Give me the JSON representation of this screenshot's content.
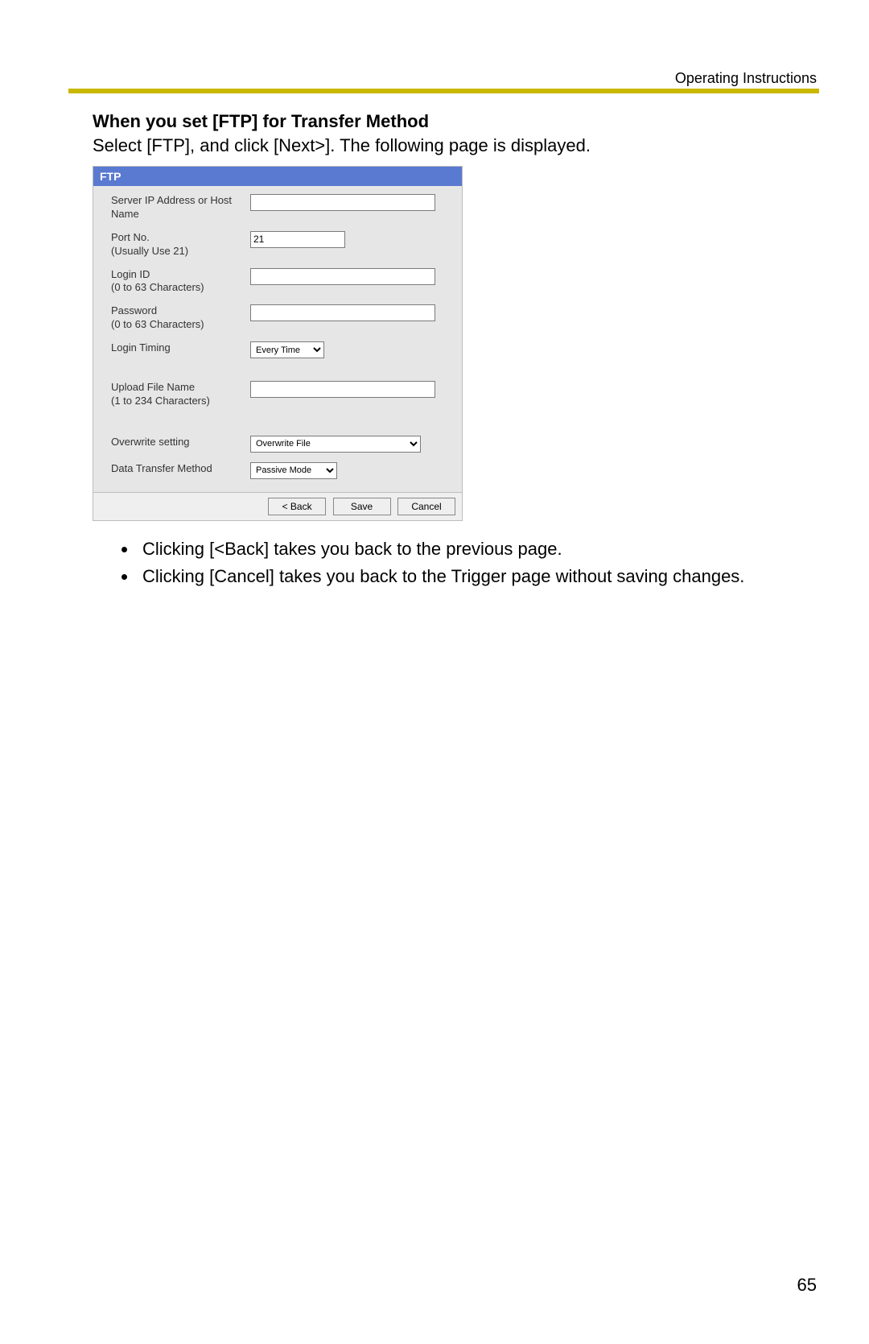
{
  "header": {
    "doc_label": "Operating Instructions"
  },
  "section": {
    "title": "When you set [FTP] for Transfer Method",
    "intro": "Select [FTP], and click [Next>]. The following page is displayed."
  },
  "ftp": {
    "title": "FTP",
    "fields": {
      "server": {
        "label_line1": "Server IP Address or Host",
        "label_line2": "Name",
        "value": ""
      },
      "port": {
        "label_line1": "Port No.",
        "label_line2": "(Usually Use 21)",
        "value": "21"
      },
      "login": {
        "label_line1": "Login ID",
        "label_line2": "(0 to 63 Characters)",
        "value": ""
      },
      "password": {
        "label_line1": "Password",
        "label_line2": "(0 to 63 Characters)",
        "value": ""
      },
      "timing": {
        "label": "Login Timing",
        "value": "Every Time"
      },
      "upload": {
        "label_line1": "Upload File Name",
        "label_line2": "(1 to 234 Characters)",
        "value": ""
      },
      "overwrite": {
        "label": "Overwrite setting",
        "value": "Overwrite File"
      },
      "transfer": {
        "label": "Data Transfer Method",
        "value": "Passive Mode"
      }
    },
    "buttons": {
      "back": "< Back",
      "save": "Save",
      "cancel": "Cancel"
    }
  },
  "bullets": [
    "Clicking [<Back] takes you back to the previous page.",
    "Clicking [Cancel] takes you back to the Trigger page without saving changes."
  ],
  "page_number": "65"
}
